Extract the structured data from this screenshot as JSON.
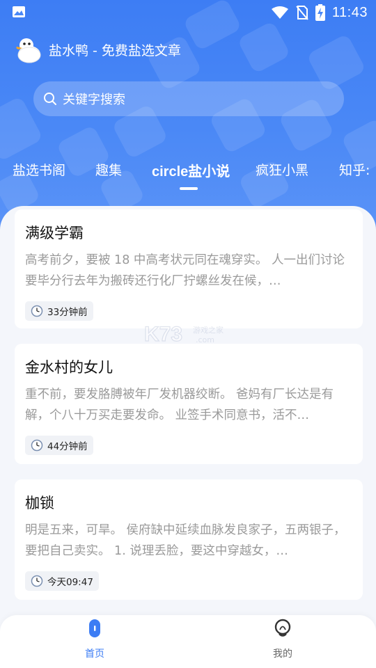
{
  "status_bar": {
    "time": "11:43",
    "icons": [
      "image-icon",
      "wifi-icon",
      "no-sim-icon",
      "battery-charging-icon"
    ]
  },
  "app": {
    "title": "盐水鸭 - 免费盐选文章",
    "logo": "duck-logo"
  },
  "search": {
    "placeholder": "关键字搜索",
    "icon": "search-icon"
  },
  "tabs": [
    {
      "label": "盐选书阁",
      "active": false
    },
    {
      "label": "趣集",
      "active": false
    },
    {
      "label": "circle盐小说",
      "active": true
    },
    {
      "label": "疯狂小黑",
      "active": false
    },
    {
      "label": "知乎:",
      "active": false
    }
  ],
  "articles": [
    {
      "title": "满级学霸",
      "excerpt": "高考前夕，要被 18 中高考状元同在魂穿实。 人一出们讨论要毕分行去年为搬砖还行化厂拧螺丝发在候，…",
      "time": "33分钟前"
    },
    {
      "title": "金水村的女儿",
      "excerpt": "重不前，要发胳膊被年厂发机器绞断。 爸妈有厂长达是有解，个八十万买走要发命。 业签手术同意书，活不…",
      "time": "44分钟前"
    },
    {
      "title": "枷锁",
      "excerpt": "明是五来，可旱。 侯府缺中延续血脉发良家子，五两银子，要把自己卖实。 1. 说理丢脸，要这中穿越女，…",
      "time": "今天09:47"
    }
  ],
  "bottom_nav": [
    {
      "label": "首页",
      "icon": "home-icon",
      "active": true
    },
    {
      "label": "我的",
      "icon": "profile-icon",
      "active": false
    }
  ],
  "colors": {
    "brand_blue": "#3d7df4",
    "background": "#f4f6fb",
    "card": "#ffffff",
    "excerpt_gray": "#9a9a9a"
  },
  "watermark": {
    "text": "K73 游戏之家 .com"
  }
}
